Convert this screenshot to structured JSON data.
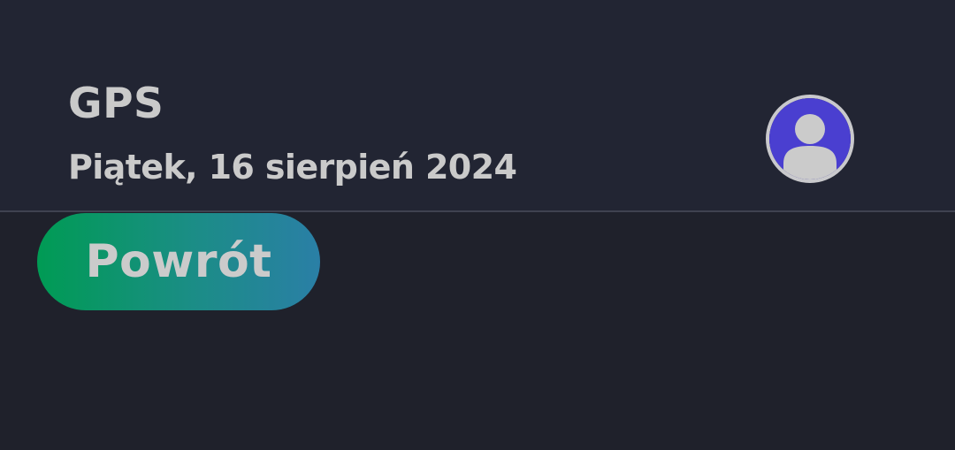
{
  "header": {
    "title": "GPS",
    "date": "Piątek, 16 sierpień 2024",
    "avatar_icon": "user-avatar-icon"
  },
  "actions": {
    "back_label": "Powrót"
  },
  "colors": {
    "background": "#1f212b",
    "header_background": "#222533",
    "text": "#cacaca",
    "avatar_fill": "#4a3fd0",
    "button_gradient_start": "#009b54",
    "button_gradient_end": "#2a7fa6"
  }
}
